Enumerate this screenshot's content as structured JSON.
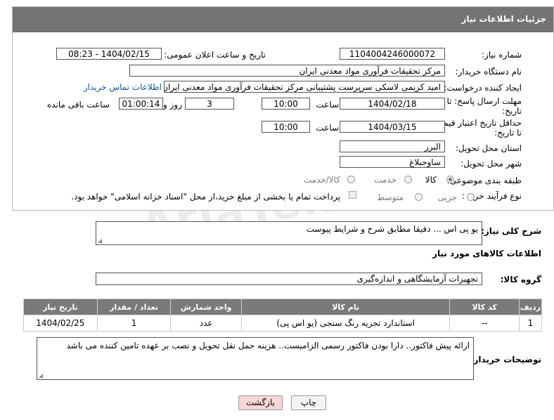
{
  "header": {
    "title": "جزئیات اطلاعات نیاز"
  },
  "form": {
    "need_number_label": "شماره نیاز:",
    "need_number": "1104004246000072",
    "announce_label": "تاریخ و ساعت اعلان عمومی:",
    "announce_value": "1404/02/15 - 08:23",
    "buyer_org_label": "نام دستگاه خریدار:",
    "buyer_org": "مرکز تحقیقات فرآوری مواد معدنی ایران",
    "creator_label": "ایجاد کننده درخواست:",
    "creator": "امید کریمی لاسکی سرپرست پشتیبانی مرکز تحقیقات فرآوری مواد معدنی ایران",
    "contact_link": "اطلاعات تماس خریدار",
    "deadline_label_1": "مهلت ارسال پاسخ: تا",
    "deadline_label_2": "تاریخ:",
    "deadline_date": "1404/02/18",
    "time_label": "ساعت",
    "deadline_time": "10:00",
    "days_value": "3",
    "days_label": "روز و",
    "remaining_value": "01:00:14",
    "remaining_label": "ساعت باقی مانده",
    "min_price_label_1": "حداقل تاریخ اعتبار قیمت:",
    "min_price_label_2": "تا تاریخ:",
    "price_date": "1404/03/15",
    "price_time": "10:00",
    "province_label": "استان محل تحویل:",
    "province": "البرز",
    "city_label": "شهر محل تحویل:",
    "city": "ساوجبلاغ",
    "category_label": "طبقه بندی موضوعی:",
    "category_options": [
      "کالا",
      "خدمت",
      "کالا/خدمت"
    ],
    "category_selected": "کالا",
    "process_label": "نوع فرآیند خرید :",
    "process_options": [
      "جزیی",
      "متوسط"
    ],
    "process_selected": "",
    "payment_note": "پرداخت تمام یا بخشی از مبلغ خرید،از محل \"اسناد خزانه اسلامی\" خواهد بود."
  },
  "summary": {
    "label": "شرح کلی نیاز:",
    "value": "یو پی اس ... دقیقا مطابق شرح و شرایط پیوست"
  },
  "goods": {
    "section_title": "اطلاعات کالاهای مورد نیاز",
    "group_label": "گروه کالا:",
    "group_value": "تجهیزات آزمایشگاهی و اندازه‌گیری",
    "columns": [
      "ردیف",
      "کد کالا",
      "نام کالا",
      "واحد شمارش",
      "تعداد / مقدار",
      "تاریخ نیاز"
    ],
    "rows": [
      [
        "1",
        "--",
        "استاندارد تجزیه رنگ سنجی (یو اس پی)",
        "عدد",
        "1",
        "1404/02/25"
      ]
    ]
  },
  "buyer_notes": {
    "label": "توضیحات خریدار:",
    "value": "ارائه پیش فاکتور.. دارا بودن فاکتور رسمی الزامیست.. هزینه حمل نقل تحویل  و نصب بر عهده تامین کننده می باشد"
  },
  "buttons": {
    "print": "چاپ",
    "back": "بازگشت"
  },
  "watermark": "AriaTender.neT",
  "colors": {
    "header_bg": "#747474",
    "table_header_bg": "#7a7a7a",
    "link": "#0a58a6",
    "back_button_bg": "#f7d7d7"
  }
}
